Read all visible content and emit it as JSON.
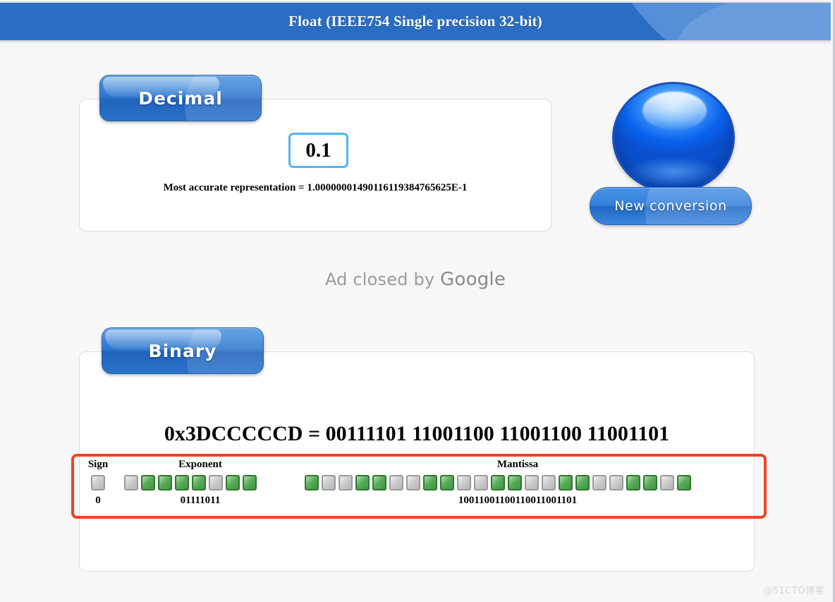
{
  "banner": {
    "title": "Float (IEEE754 Single precision 32-bit)",
    "bg_color": "#2a6ec4"
  },
  "decimal": {
    "tab_label": "Decimal",
    "value": "0.1",
    "note": "Most accurate representation = 1.00000001490116119384765625E-1"
  },
  "conversion": {
    "button_label": "New conversion",
    "sphere_color": "#0a62ef"
  },
  "ad": {
    "text_prefix": "Ad closed by ",
    "brand": "Google"
  },
  "binary": {
    "tab_label": "Binary",
    "hex_line": "0x3DCCCCCD = 00111101 11001100 11001100 11001101",
    "highlight_color": "#ee4422",
    "fields": {
      "sign": {
        "title": "Sign",
        "bits": "0",
        "value": "0"
      },
      "exponent": {
        "title": "Exponent",
        "bits": "01111011",
        "value": "01111011"
      },
      "mantissa": {
        "title": "Mantissa",
        "bits": "10011001100110011001101",
        "value": "10011001100110011001101"
      }
    },
    "bit_colors": {
      "on": "#4aa34a",
      "off": "#c4c4c4"
    }
  },
  "watermark": {
    "text": "@51CTO博客"
  }
}
